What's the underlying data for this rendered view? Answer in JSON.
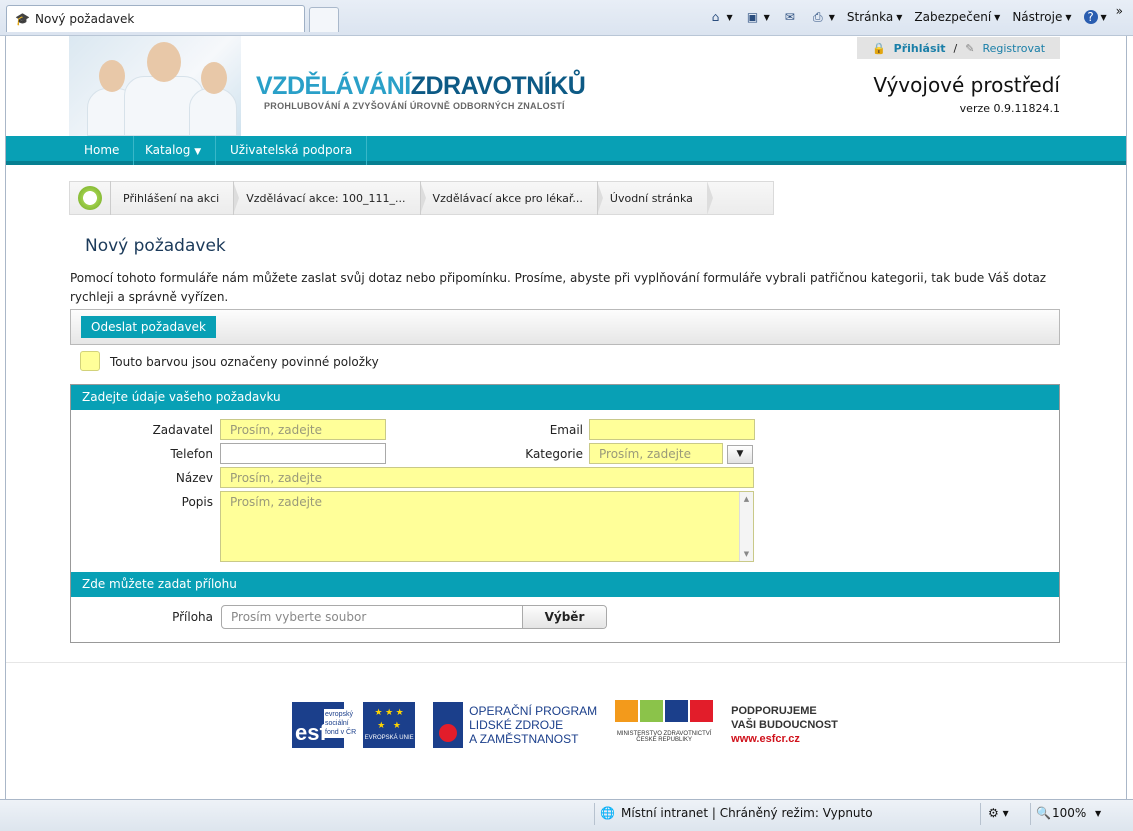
{
  "browser": {
    "tab_title": "Nový požadavek",
    "cmd": {
      "page": "Stránka",
      "security": "Zabezpečení",
      "tools": "Nástroje"
    },
    "chevron": "»"
  },
  "header": {
    "brand_part1": "VZDĚLÁVÁNÍ",
    "brand_part2": "ZDRAVOTNÍKŮ",
    "brand_sub": "PROHLUBOVÁNÍ A ZVYŠOVÁNÍ ÚROVNĚ ODBORNÝCH ZNALOSTÍ",
    "login": "Přihlásit",
    "separator": "/",
    "register": "Registrovat",
    "environment": "Vývojové prostředí",
    "version": "verze 0.9.11824.1",
    "brand_colors": {
      "light": "#2aa0c8",
      "dark": "#0d5a85"
    }
  },
  "nav": {
    "home": "Home",
    "catalog": "Katalog",
    "support": "Uživatelská podpora",
    "accent": "#08a0b5"
  },
  "breadcrumbs": [
    "Přihlášení na akci",
    "Vzdělávací akce: 100_111_...",
    "Vzdělávací akce pro lékař...",
    "Úvodní stránka"
  ],
  "page": {
    "title": "Nový požadavek",
    "intro": "Pomocí tohoto formuláře nám můžete zaslat svůj dotaz nebo připomínku. Prosíme, abyste při vyplňování formuláře vybrali patřičnou kategorii, tak bude Váš dotaz rychleji a správně vyřízen.",
    "send_button": "Odeslat požadavek",
    "legend": "Touto barvou jsou označeny povinné položky",
    "required_color": "#ffff99"
  },
  "form": {
    "section1": "Zadejte údaje vašeho požadavku",
    "requester_label": "Zadavatel",
    "requester_placeholder": "Prosím, zadejte",
    "email_label": "Email",
    "phone_label": "Telefon",
    "category_label": "Kategorie",
    "category_placeholder": "Prosím, zadejte",
    "name_label": "Název",
    "name_placeholder": "Prosím, zadejte",
    "desc_label": "Popis",
    "desc_placeholder": "Prosím, zadejte",
    "section2": "Zde můžete zadat přílohu",
    "attachment_label": "Příloha",
    "attachment_placeholder": "Prosím vyberte soubor",
    "browse_button": "Výběr"
  },
  "footer": {
    "esf_lines": [
      "evropský",
      "sociální",
      "fond v ČR"
    ],
    "esf_word": "esf",
    "eu_label": "EVROPSKÁ UNIE",
    "op_lines": [
      "OPERAČNÍ PROGRAM",
      "LIDSKÉ ZDROJE",
      "A ZAMĚSTNANOST"
    ],
    "ministry": "MINISTERSTVO ZDRAVOTNICTVÍ",
    "ministry2": "ČESKÉ REPUBLIKY",
    "support_lines": [
      "PODPORUJEME",
      "VAŠI BUDOUCNOST"
    ],
    "web": "www.esfcr.cz"
  },
  "status": {
    "zone": "Místní intranet | Chráněný režim: Vypnuto",
    "zoom": "100%"
  }
}
